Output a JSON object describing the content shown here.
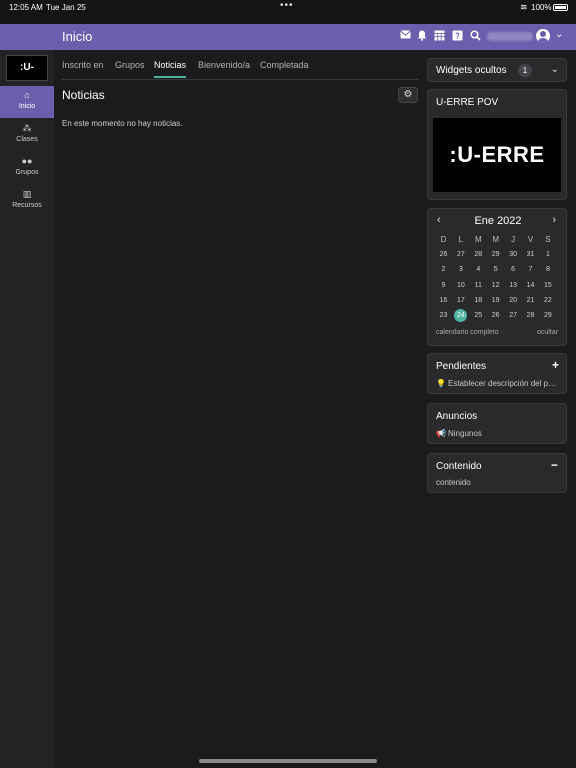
{
  "status": {
    "time": "12:05 AM",
    "date": "Tue Jan 25",
    "battery": "100%"
  },
  "header": {
    "title": "Inicio",
    "icons": [
      "mail-icon",
      "bell-icon",
      "calendar-icon",
      "help-icon",
      "search-icon"
    ]
  },
  "brand": {
    "logo_text": ":U-ERRE",
    "accent": "#6a5fad",
    "highlight": "#4fb3a1"
  },
  "sidebar": {
    "items": [
      {
        "label": "Inicio",
        "icon": "home-icon"
      },
      {
        "label": "Clases",
        "icon": "classes-icon"
      },
      {
        "label": "Grupos",
        "icon": "groups-icon"
      },
      {
        "label": "Recursos",
        "icon": "resources-icon"
      }
    ]
  },
  "main": {
    "tabs": [
      {
        "label": "Inscrito en"
      },
      {
        "label": "Grupos"
      },
      {
        "label": "Noticias"
      },
      {
        "label": "Bienvenido/a"
      },
      {
        "label": "Completada"
      }
    ],
    "active_tab": "Noticias",
    "section_title": "Noticias",
    "empty_message": "En este momento no hay noticias."
  },
  "widgets": {
    "hidden": {
      "title": "Widgets ocultos",
      "count": "1"
    },
    "pov": {
      "title": "U-ERRE POV",
      "image_text": ":U-ERRE"
    },
    "calendar": {
      "month": "Ene 2022",
      "weekdays": [
        "D",
        "L",
        "M",
        "M",
        "J",
        "V",
        "S"
      ],
      "weeks": [
        [
          "26",
          "27",
          "28",
          "29",
          "30",
          "31",
          "1"
        ],
        [
          "2",
          "3",
          "4",
          "5",
          "6",
          "7",
          "8"
        ],
        [
          "9",
          "10",
          "11",
          "12",
          "13",
          "14",
          "15"
        ],
        [
          "16",
          "17",
          "18",
          "19",
          "20",
          "21",
          "22"
        ],
        [
          "23",
          "24",
          "25",
          "26",
          "27",
          "28",
          "29"
        ]
      ],
      "today": "24",
      "full_link": "calendario completo",
      "hide_link": "ocultar"
    },
    "pending": {
      "title": "Pendientes",
      "item": "Establecer descripción del perfil"
    },
    "announcements": {
      "title": "Anuncios",
      "item": "Ningunos"
    },
    "content": {
      "title": "Contenido",
      "item": "contenido"
    }
  }
}
